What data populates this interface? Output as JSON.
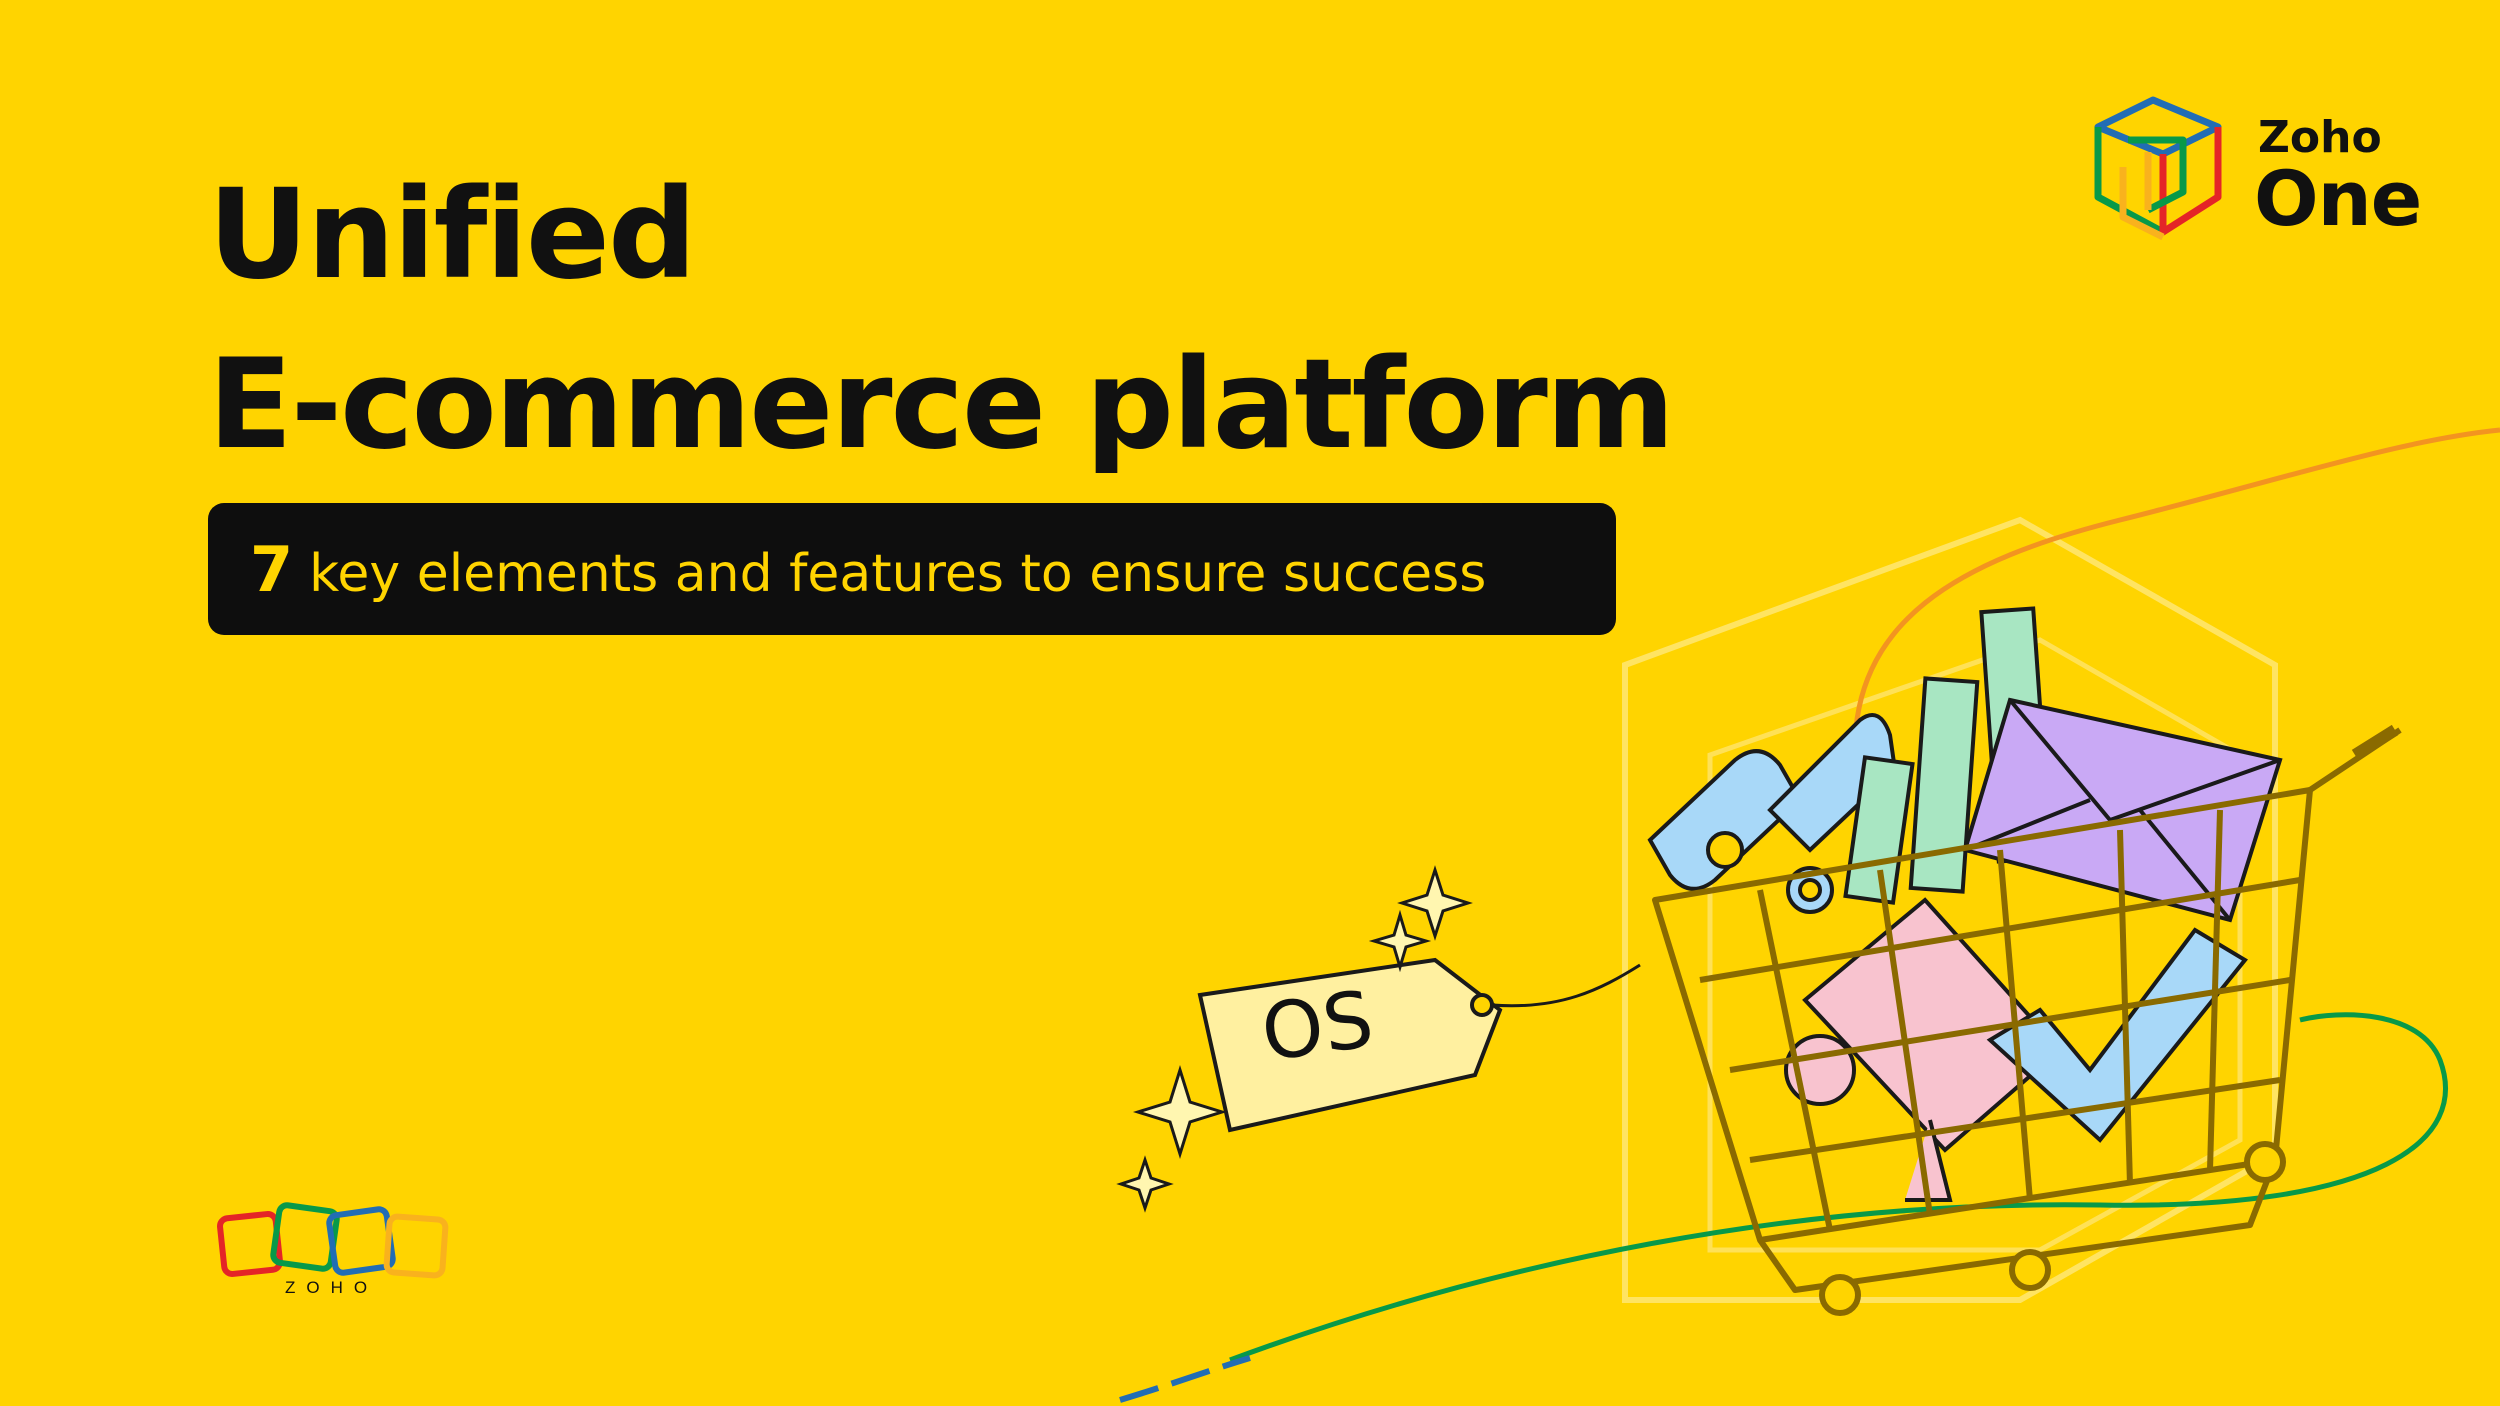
{
  "headline": {
    "line1": "Unified",
    "line2": "E-commerce platform"
  },
  "subtitle": {
    "number": "7",
    "text": "key elements and features  to ensure success"
  },
  "brand": {
    "zoho": "Zoho",
    "one": "One"
  },
  "footer_logo": {
    "word": "ZOHO"
  },
  "illustration": {
    "tag_label": "OS",
    "icons": [
      "shopping-cart-icon",
      "percent-icon",
      "bar-chart-icon",
      "envelope-icon",
      "document-icon",
      "checkmark-icon",
      "sparkle-icon",
      "price-tag-icon"
    ]
  },
  "colors": {
    "background": "#FFD400",
    "text": "#111111",
    "bar": "#0E0E0E",
    "bar_text": "#FFD400",
    "zoho_red": "#E42527",
    "zoho_green": "#089949",
    "zoho_blue": "#226DB4",
    "zoho_yellow": "#F9B21D"
  }
}
